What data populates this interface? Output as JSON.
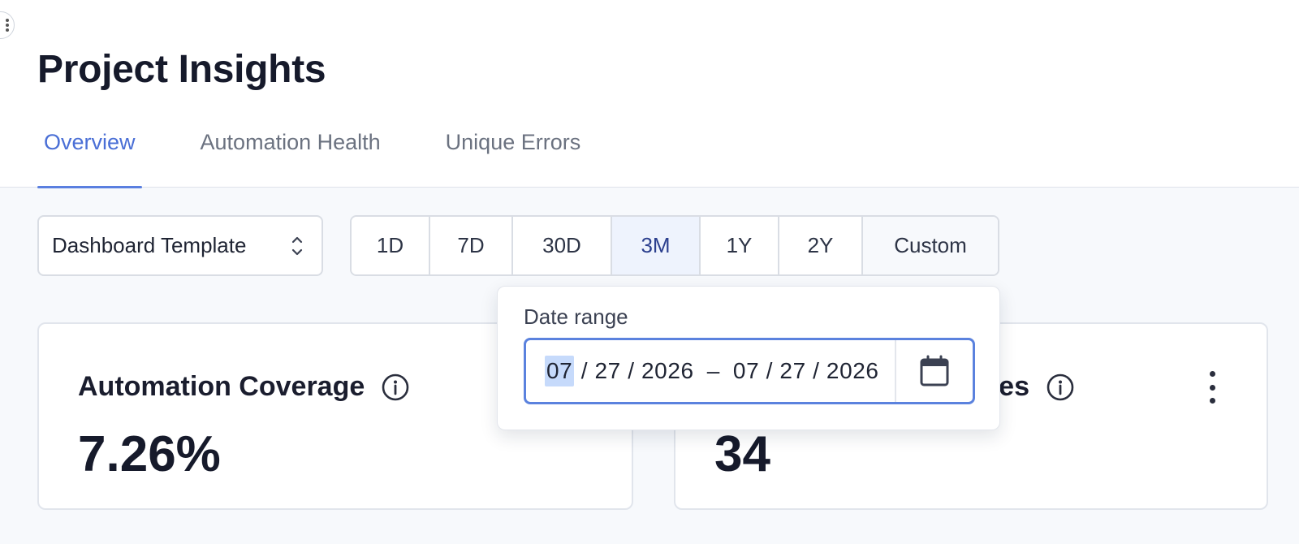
{
  "header": {
    "title": "Project Insights",
    "tabs": [
      {
        "label": "Overview",
        "active": true
      },
      {
        "label": "Automation Health",
        "active": false
      },
      {
        "label": "Unique Errors",
        "active": false
      }
    ]
  },
  "filters": {
    "template_value": "Dashboard Template",
    "ranges": [
      "1D",
      "7D",
      "30D",
      "3M",
      "1Y",
      "2Y",
      "Custom"
    ],
    "active_range": "3M"
  },
  "date_popover": {
    "label": "Date range",
    "start": {
      "month": "07",
      "day": "27",
      "year": "2026"
    },
    "separator": "–",
    "end": {
      "month": "07",
      "day": "27",
      "year": "2026"
    }
  },
  "cards": [
    {
      "title": "Automation Coverage",
      "value": "7.26%"
    },
    {
      "title_visible_suffix": "es",
      "value": "34"
    }
  ],
  "colors": {
    "accent": "#4a6fd6",
    "active_range_bg": "#eef3fd",
    "focus_border": "#5b82de"
  },
  "icons": {
    "select": "chevron-up-down-icon",
    "info": "info-circle-icon",
    "calendar": "calendar-icon",
    "more": "kebab-menu-icon"
  }
}
